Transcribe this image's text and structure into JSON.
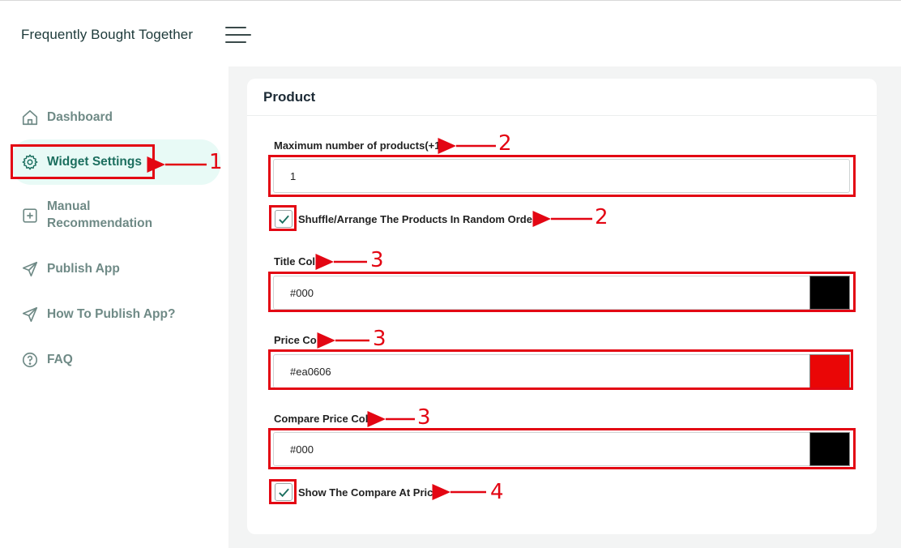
{
  "app": {
    "title": "Frequently Bought Together"
  },
  "sidebar": {
    "items": [
      {
        "label": "Dashboard",
        "icon": "home-icon"
      },
      {
        "label": "Widget Settings",
        "icon": "gear-icon",
        "active": true
      },
      {
        "label_line1": "Manual",
        "label_line2": "Recommendation",
        "icon": "plus-square-icon"
      },
      {
        "label": "Publish App",
        "icon": "send-icon"
      },
      {
        "label": "How To Publish App?",
        "icon": "send-icon"
      },
      {
        "label": "FAQ",
        "icon": "question-circle-icon"
      }
    ]
  },
  "card": {
    "title": "Product",
    "max_products": {
      "label": "Maximum number of products(+1)",
      "value": "1"
    },
    "shuffle": {
      "label": "Shuffle/Arrange The Products In Random Order",
      "checked": true
    },
    "title_color": {
      "label": "Title Color",
      "value": "#000",
      "swatch": "#000000"
    },
    "price_color": {
      "label": "Price Color",
      "value": "#ea0606",
      "swatch": "#ea0606"
    },
    "compare_price_color": {
      "label": "Compare Price Color",
      "value": "#000",
      "swatch": "#000000"
    },
    "show_compare": {
      "label": "Show The Compare At Price",
      "checked": true
    }
  },
  "annotations": {
    "color": "#e30613",
    "numbers": [
      "1",
      "2",
      "2",
      "3",
      "3",
      "3",
      "4"
    ]
  }
}
